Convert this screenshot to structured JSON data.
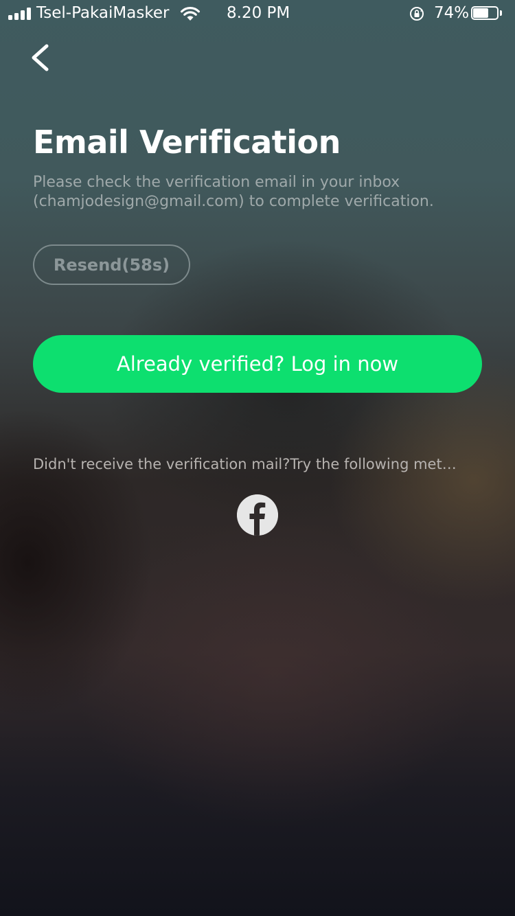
{
  "status_bar": {
    "carrier": "Tsel-PakaiMasker",
    "time": "8.20 PM",
    "battery_percent": "74%",
    "battery_level": 0.74
  },
  "header": {
    "back_icon": "chevron-left-icon"
  },
  "main": {
    "title": "Email Verification",
    "instructions_line1": "Please check the verification email in your inbox",
    "instructions_line2": "(chamjodesign@gmail.com) to complete verification.",
    "resend_label": "Resend(58s)",
    "login_label": "Already verified? Log in now",
    "help_text": "Didn't receive the verification mail?Try the following met…",
    "alt_method_icon": "facebook-icon"
  },
  "colors": {
    "accent": "#0ddf6f",
    "text_primary": "#ffffff",
    "text_secondary": "#9fa9aa"
  }
}
